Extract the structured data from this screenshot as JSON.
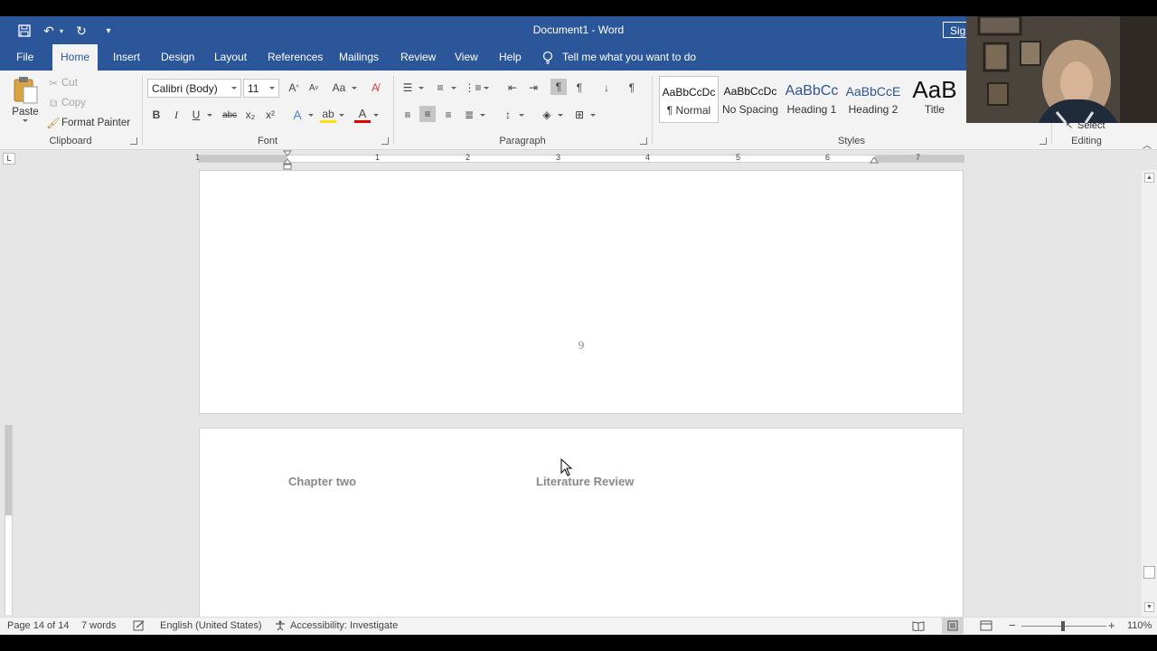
{
  "window": {
    "title": "Document1  -  Word",
    "signin_label": "Sig"
  },
  "tabs": [
    "File",
    "Home",
    "Insert",
    "Design",
    "Layout",
    "References",
    "Mailings",
    "Review",
    "View",
    "Help"
  ],
  "tell_me": "Tell me what you want to do",
  "clipboard": {
    "paste": "Paste",
    "cut": "Cut",
    "copy": "Copy",
    "format_painter": "Format Painter",
    "label": "Clipboard"
  },
  "font": {
    "name": "Calibri (Body)",
    "size": "11",
    "label": "Font",
    "bold": "B",
    "italic": "I",
    "underline": "U",
    "strike": "abc",
    "sub": "x₂",
    "sup": "x²"
  },
  "paragraph": {
    "label": "Paragraph"
  },
  "styles": {
    "label": "Styles",
    "items": [
      {
        "preview": "AaBbCcDc",
        "name": "¶ Normal"
      },
      {
        "preview": "AaBbCcDc",
        "name": "No Spacing"
      },
      {
        "preview": "AaBbCc",
        "name": "Heading 1"
      },
      {
        "preview": "AaBbCcE",
        "name": "Heading 2"
      },
      {
        "preview": "AaB",
        "name": "Title"
      }
    ]
  },
  "editing": {
    "label": "Editing",
    "select": "Select"
  },
  "ruler": {
    "numbers": [
      "1",
      "1",
      "2",
      "3",
      "4",
      "5",
      "6",
      "7"
    ]
  },
  "document": {
    "page_number": "9",
    "chapter": "Chapter two",
    "chapter_title": "Literature Review"
  },
  "status": {
    "page": "Page 14 of 14",
    "words": "7 words",
    "language": "English (United States)",
    "accessibility": "Accessibility: Investigate",
    "zoom": "110%"
  },
  "colors": {
    "brand": "#2b579a",
    "highlight": "#ffe000",
    "font_color": "#e00000"
  }
}
